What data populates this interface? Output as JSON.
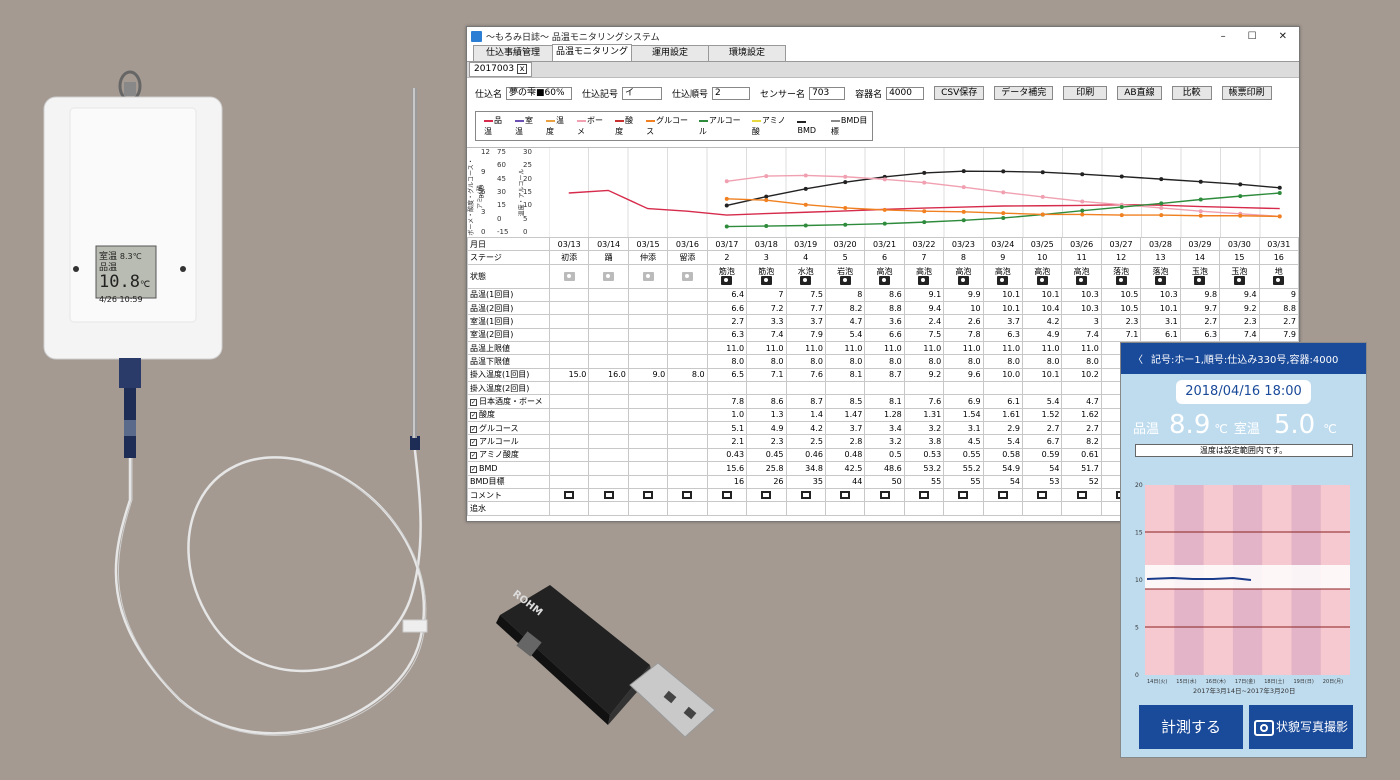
{
  "window": {
    "title": "～もろみ日誌～ 品温モニタリングシステム"
  },
  "tabs": [
    "仕込事績管理",
    "品温モニタリング",
    "運用設定",
    "環境設定"
  ],
  "subtab": {
    "label": "2017003",
    "close": "x"
  },
  "fields": {
    "shikomi_label": "仕込名",
    "shikomi_value": "夢の雫■60%",
    "kigou_label": "仕込記号",
    "kigou_value": "イ",
    "junban_label": "仕込順号",
    "junban_value": "2",
    "sensor_label": "センサー名",
    "sensor_value": "703",
    "youki_label": "容器名",
    "youki_value": "4000"
  },
  "buttons": [
    "CSV保存",
    "データ補完",
    "印刷",
    "AB直線",
    "比較",
    "帳票印刷"
  ],
  "legend": [
    {
      "name": "品温",
      "color": "#d62b4b"
    },
    {
      "name": "室温",
      "color": "#6b4fb3"
    },
    {
      "name": "温度",
      "color": "#e8a040"
    },
    {
      "name": "ボーメ",
      "color": "#f0a0b0"
    },
    {
      "name": "酸度",
      "color": "#c83030"
    },
    {
      "name": "グルコース",
      "color": "#f08020"
    },
    {
      "name": "アルコール",
      "color": "#2e8b3c"
    },
    {
      "name": "アミノ酸",
      "color": "#e8d840"
    },
    {
      "name": "BMD",
      "color": "#222222"
    },
    {
      "name": "BMD目標",
      "color": "#888888"
    }
  ],
  "axis": {
    "title_left": "ボーメ・酸度・グルコース・アミノ酸",
    "title_mid": "BMD",
    "title_right": "温度・アルコール",
    "ticks_left": [
      "12",
      "9",
      "6",
      "3",
      "0"
    ],
    "ticks_mid": [
      "75",
      "60",
      "45",
      "30",
      "15",
      "0",
      "-15"
    ],
    "ticks_right": [
      "30",
      "25",
      "20",
      "15",
      "10",
      "5",
      "0"
    ]
  },
  "table": {
    "dates_label": "月日",
    "dates": [
      "03/13",
      "03/14",
      "03/15",
      "03/16",
      "03/17",
      "03/18",
      "03/19",
      "03/20",
      "03/21",
      "03/22",
      "03/23",
      "03/24",
      "03/25",
      "03/26",
      "03/27",
      "03/28",
      "03/29",
      "03/30",
      "03/31"
    ],
    "stage_label": "ステージ",
    "stages": [
      "初添",
      "踊",
      "仲添",
      "留添",
      "2",
      "3",
      "4",
      "5",
      "6",
      "7",
      "8",
      "9",
      "10",
      "11",
      "12",
      "13",
      "14",
      "15",
      "16"
    ],
    "state_label": "状態",
    "states": [
      "",
      "",
      "",
      "",
      "筋泡",
      "筋泡",
      "水泡",
      "岩泡",
      "高泡",
      "高泡",
      "高泡",
      "高泡",
      "高泡",
      "高泡",
      "落泡",
      "落泡",
      "玉泡",
      "玉泡",
      "地"
    ],
    "rows": [
      {
        "label": "品温(1回目)",
        "values": [
          "",
          "",
          "",
          "",
          "6.4",
          "7",
          "7.5",
          "8",
          "8.6",
          "9.1",
          "9.9",
          "10.1",
          "10.1",
          "10.3",
          "10.5",
          "10.3",
          "9.8",
          "9.4",
          "9"
        ]
      },
      {
        "label": "品温(2回目)",
        "values": [
          "",
          "",
          "",
          "",
          "6.6",
          "7.2",
          "7.7",
          "8.2",
          "8.8",
          "9.4",
          "10",
          "10.1",
          "10.4",
          "10.3",
          "10.5",
          "10.1",
          "9.7",
          "9.2",
          "8.8"
        ]
      },
      {
        "label": "室温(1回目)",
        "values": [
          "",
          "",
          "",
          "",
          "2.7",
          "3.3",
          "3.7",
          "4.7",
          "3.6",
          "2.4",
          "2.6",
          "3.7",
          "4.2",
          "3",
          "2.3",
          "3.1",
          "2.7",
          "2.3",
          "2.7"
        ]
      },
      {
        "label": "室温(2回目)",
        "values": [
          "",
          "",
          "",
          "",
          "6.3",
          "7.4",
          "7.9",
          "5.4",
          "6.6",
          "7.5",
          "7.8",
          "6.3",
          "4.9",
          "7.4",
          "7.1",
          "6.1",
          "6.3",
          "7.4",
          "7.9"
        ]
      },
      {
        "label": "品温上限値",
        "values": [
          "",
          "",
          "",
          "",
          "11.0",
          "11.0",
          "11.0",
          "11.0",
          "11.0",
          "11.0",
          "11.0",
          "11.0",
          "11.0",
          "11.0",
          "",
          "",
          "",
          "",
          ""
        ]
      },
      {
        "label": "品温下限値",
        "values": [
          "",
          "",
          "",
          "",
          "8.0",
          "8.0",
          "8.0",
          "8.0",
          "8.0",
          "8.0",
          "8.0",
          "8.0",
          "8.0",
          "8.0",
          "",
          "",
          "",
          "",
          ""
        ]
      },
      {
        "label": "掛入温度(1回目)",
        "values": [
          "15.0",
          "16.0",
          "9.0",
          "8.0",
          "6.5",
          "7.1",
          "7.6",
          "8.1",
          "8.7",
          "9.2",
          "9.6",
          "10.0",
          "10.1",
          "10.2",
          "",
          "",
          "",
          "",
          ""
        ]
      },
      {
        "label": "掛入温度(2回目)",
        "values": [
          "",
          "",
          "",
          "",
          "",
          "",
          "",
          "",
          "",
          "",
          "",
          "",
          "",
          "",
          "",
          "",
          "",
          "",
          ""
        ]
      },
      {
        "label": "日本酒度・ボーメ",
        "check": true,
        "values": [
          "",
          "",
          "",
          "",
          "7.8",
          "8.6",
          "8.7",
          "8.5",
          "8.1",
          "7.6",
          "6.9",
          "6.1",
          "5.4",
          "4.7",
          "",
          "",
          "",
          "",
          ""
        ]
      },
      {
        "label": "酸度",
        "check": true,
        "values": [
          "",
          "",
          "",
          "",
          "1.0",
          "1.3",
          "1.4",
          "1.47",
          "1.28",
          "1.31",
          "1.54",
          "1.61",
          "1.52",
          "1.62",
          "",
          "",
          "",
          "",
          ""
        ]
      },
      {
        "label": "グルコース",
        "check": true,
        "values": [
          "",
          "",
          "",
          "",
          "5.1",
          "4.9",
          "4.2",
          "3.7",
          "3.4",
          "3.2",
          "3.1",
          "2.9",
          "2.7",
          "2.7",
          "",
          "",
          "",
          "",
          ""
        ]
      },
      {
        "label": "アルコール",
        "check": true,
        "values": [
          "",
          "",
          "",
          "",
          "2.1",
          "2.3",
          "2.5",
          "2.8",
          "3.2",
          "3.8",
          "4.5",
          "5.4",
          "6.7",
          "8.2",
          "",
          "",
          "",
          "",
          ""
        ]
      },
      {
        "label": "アミノ酸度",
        "check": true,
        "values": [
          "",
          "",
          "",
          "",
          "0.43",
          "0.45",
          "0.46",
          "0.48",
          "0.5",
          "0.53",
          "0.55",
          "0.58",
          "0.59",
          "0.61",
          "",
          "",
          "",
          "",
          ""
        ]
      },
      {
        "label": "BMD",
        "check": true,
        "values": [
          "",
          "",
          "",
          "",
          "15.6",
          "25.8",
          "34.8",
          "42.5",
          "48.6",
          "53.2",
          "55.2",
          "54.9",
          "54",
          "51.7",
          "",
          "",
          "",
          "",
          ""
        ]
      },
      {
        "label": "BMD目標",
        "values": [
          "",
          "",
          "",
          "",
          "16",
          "26",
          "35",
          "44",
          "50",
          "55",
          "55",
          "54",
          "53",
          "52",
          "5",
          "",
          "",
          "",
          ""
        ]
      }
    ],
    "comment_label": "コメント",
    "water_label": "追水"
  },
  "device": {
    "room_label": "室温",
    "room_value": "8.3℃",
    "hin_label": "品温",
    "hin_value": "10.8",
    "hin_unit": "℃",
    "datetime": "4/26 10:59"
  },
  "usb": {
    "brand": "ROHM"
  },
  "phone": {
    "header": "記号:ホー1,順号:仕込み330号,容器:4000",
    "back": "〈",
    "datetime": "2018/04/16 18:00",
    "hin_label": "品温",
    "hin_value": "8.9",
    "hin_unit": "℃",
    "room_label": "室温",
    "room_value": "5.0",
    "room_unit": "℃",
    "message": "温度は設定範囲内です。",
    "yticks": [
      "20",
      "15",
      "10",
      "5",
      "0"
    ],
    "xticks": [
      "14日(火)",
      "15日(水)",
      "16日(木)",
      "17日(金)",
      "18日(土)",
      "19日(日)",
      "20日(月)"
    ],
    "range": "2017年3月14日~2017年3月20日",
    "btn_measure": "計測する",
    "btn_photo": "状貌写真撮影"
  },
  "chart_data": {
    "type": "line",
    "x": [
      "03/13",
      "03/14",
      "03/15",
      "03/16",
      "03/17",
      "03/18",
      "03/19",
      "03/20",
      "03/21",
      "03/22",
      "03/23",
      "03/24",
      "03/25",
      "03/26",
      "03/27",
      "03/28",
      "03/29",
      "03/30",
      "03/31"
    ],
    "series": [
      {
        "name": "品温",
        "values": [
          15,
          16,
          9,
          8,
          6.5,
          7.1,
          7.6,
          8.1,
          8.7,
          9.2,
          9.6,
          10,
          10.1,
          10.2,
          10.5,
          10.3,
          9.8,
          9.4,
          9
        ]
      },
      {
        "name": "BMD",
        "values": [
          null,
          null,
          null,
          null,
          15.6,
          25.8,
          34.8,
          42.5,
          48.6,
          53.2,
          55.2,
          54.9,
          54,
          51.7,
          49,
          46,
          43,
          40,
          36
        ]
      },
      {
        "name": "ボーメ",
        "values": [
          null,
          null,
          null,
          null,
          7.8,
          8.6,
          8.7,
          8.5,
          8.1,
          7.6,
          6.9,
          6.1,
          5.4,
          4.7,
          4.2,
          3.7,
          3.2,
          2.8,
          2.4
        ]
      },
      {
        "name": "アルコール",
        "values": [
          null,
          null,
          null,
          null,
          2.1,
          2.3,
          2.5,
          2.8,
          3.2,
          3.8,
          4.5,
          5.4,
          6.7,
          8.2,
          9.6,
          11,
          12.5,
          13.8,
          15
        ]
      },
      {
        "name": "グルコース",
        "values": [
          null,
          null,
          null,
          null,
          5.1,
          4.9,
          4.2,
          3.7,
          3.4,
          3.2,
          3.1,
          2.9,
          2.7,
          2.7,
          2.6,
          2.6,
          2.5,
          2.5,
          2.4
        ]
      }
    ]
  }
}
